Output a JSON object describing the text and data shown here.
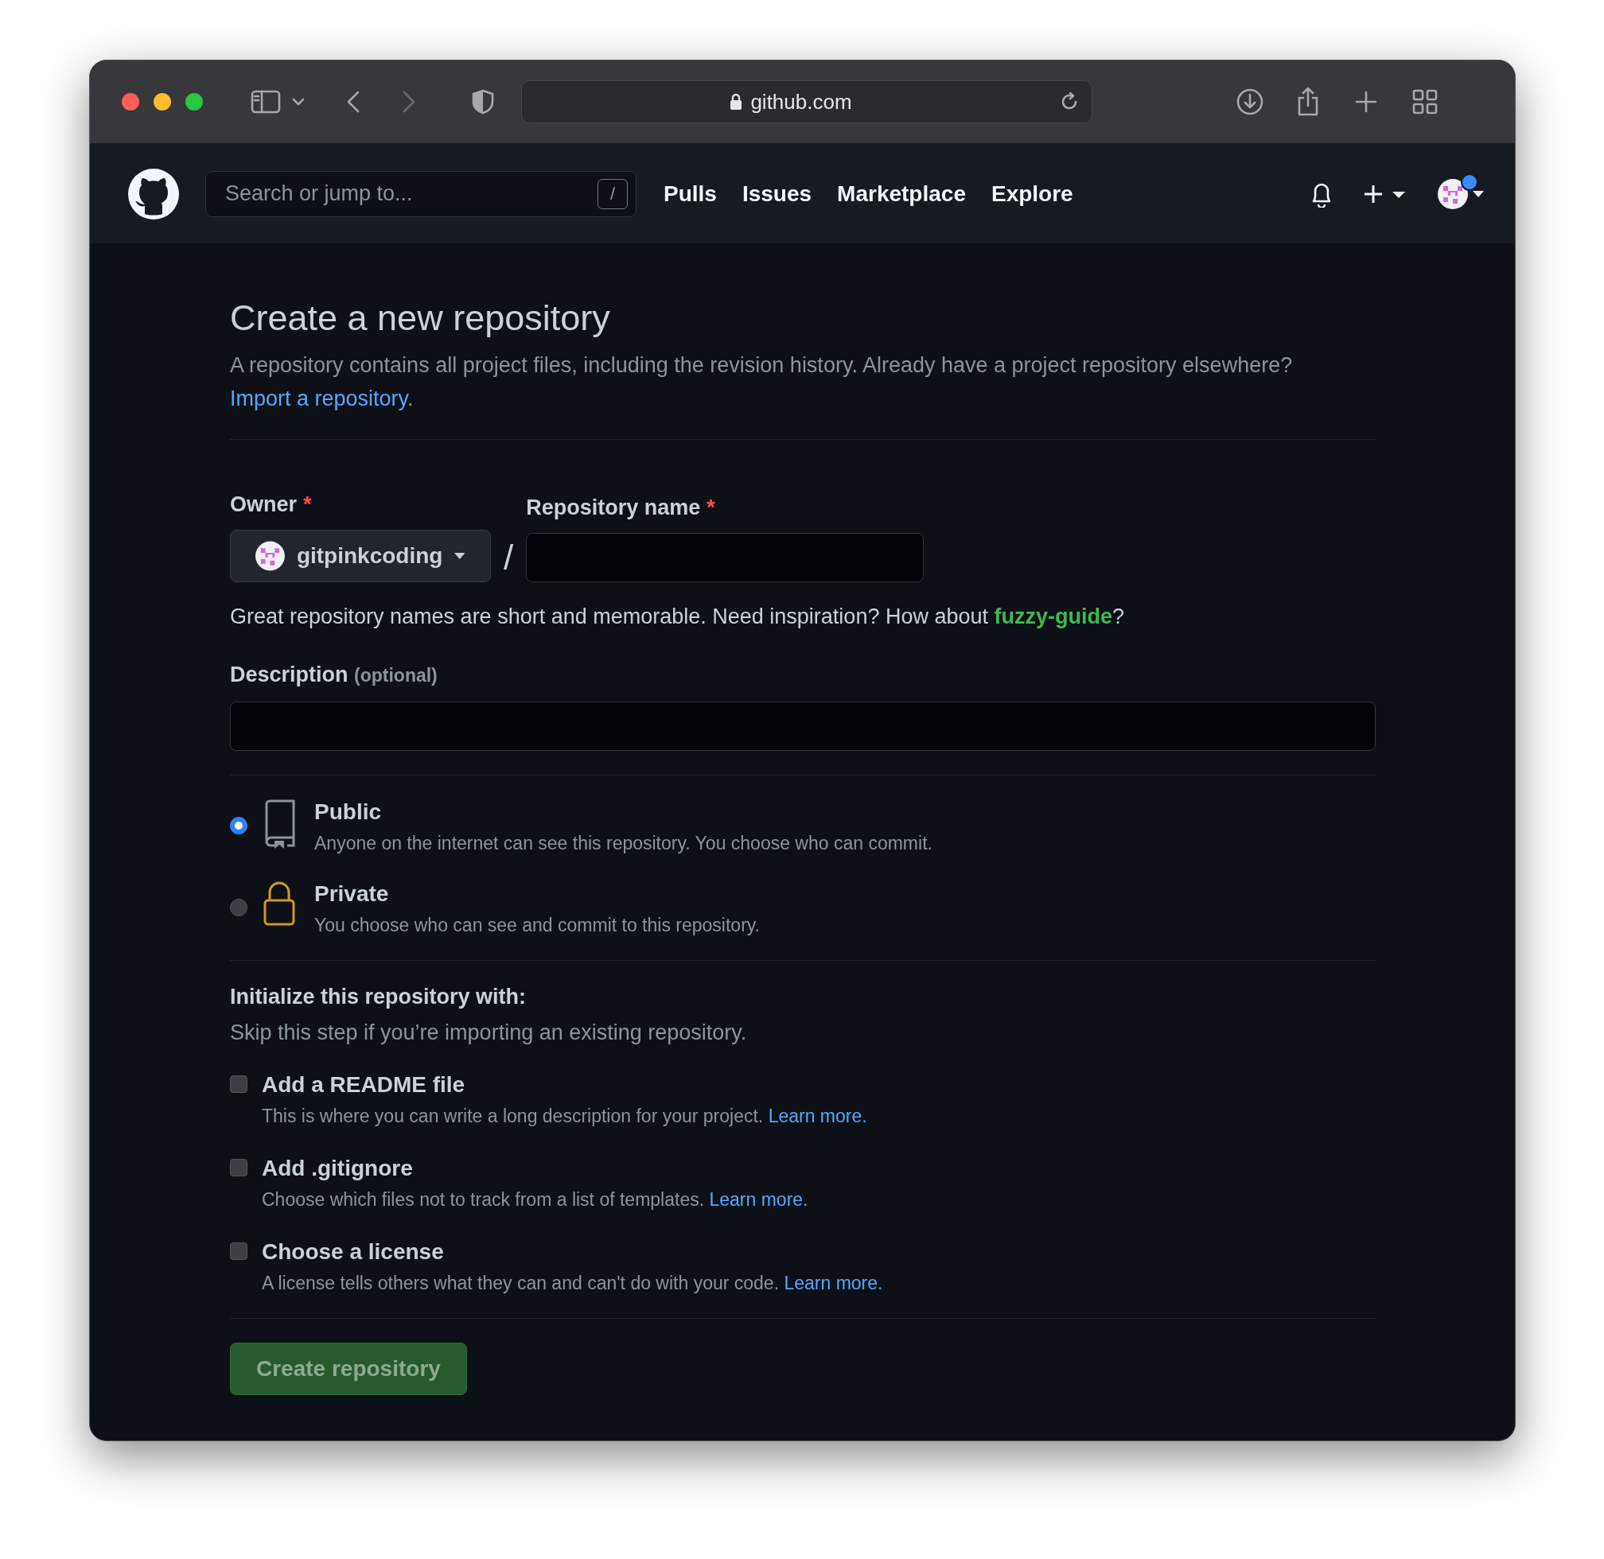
{
  "browser": {
    "url": "github.com"
  },
  "header": {
    "search": {
      "placeholder": "Search or jump to...",
      "shortcut": "/"
    },
    "nav": [
      "Pulls",
      "Issues",
      "Marketplace",
      "Explore"
    ],
    "avatar_badge": true
  },
  "page": {
    "title": "Create a new repository",
    "intro": {
      "text": "A repository contains all project files, including the revision history. Already have a project repository elsewhere? ",
      "link": "Import a repository."
    }
  },
  "owner": {
    "label": "Owner",
    "required_mark": "*",
    "value": "gitpinkcoding"
  },
  "separator": "/",
  "repo_name": {
    "label": "Repository name",
    "required_mark": "*"
  },
  "hint": {
    "before": "Great repository names are short and memorable. Need inspiration? How about ",
    "suggestion": "fuzzy-guide",
    "after": "?"
  },
  "description": {
    "label": "Description",
    "note": "(optional)"
  },
  "visibility": [
    {
      "kind": "public",
      "label": "Public",
      "description": "Anyone on the internet can see this repository. You choose who can commit.",
      "selected": true
    },
    {
      "kind": "private",
      "label": "Private",
      "description": "You choose who can see and commit to this repository.",
      "selected": false
    }
  ],
  "init": {
    "title": "Initialize this repository with:",
    "subtitle": "Skip this step if you’re importing an existing repository.",
    "options": [
      {
        "label": "Add a README file",
        "description": "This is where you can write a long description for your project. ",
        "link": "Learn more.",
        "checked": false
      },
      {
        "label": "Add .gitignore",
        "description": "Choose which files not to track from a list of templates. ",
        "link": "Learn more.",
        "checked": false
      },
      {
        "label": "Choose a license",
        "description": "A license tells others what they can and can't do with your code. ",
        "link": "Learn more.",
        "checked": false
      }
    ]
  },
  "submit": {
    "label": "Create repository",
    "disabled": true
  }
}
